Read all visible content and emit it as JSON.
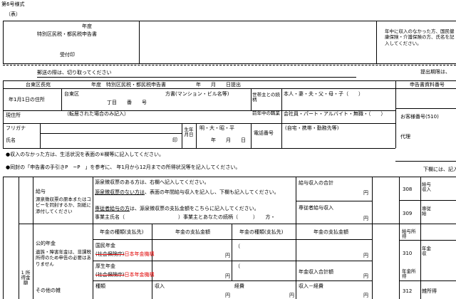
{
  "header": {
    "form_number": "第6号様式",
    "side_label": "（表）",
    "year_label": "年度",
    "form_title": "特別区民税・都民税申告書",
    "receipt": "受付印",
    "right_note": "年中に収入のなかった方、国民健康保険・介護保険の方、氏名を記入してください。",
    "postmark_note": "郵送の際は、切り取ってください",
    "submit_date_label": "提出期限は、"
  },
  "address_block": {
    "ward_head": "台東区長宛",
    "submit_line": "年度　特別区民税・都民税申告書　　　　　　年　　月　　日提出",
    "doc_number_label": "申告書資料番号",
    "jan1_address_label": "年1月1日の住所",
    "ward_name": "台東区",
    "building_label": "方書(マンション・ビル名等)",
    "chome_label": "丁目　　番　　号",
    "householder_label": "世帯主との続柄",
    "relation_options": "本人・妻・夫・父・母・子（　　）",
    "current_address_label": "現住所",
    "current_note": "（転居された場合のみ記入）",
    "previous_job_label": "前年中の職業",
    "job_options": "会社員・パート・アルバイト・無職・（　　）",
    "account_label": "お客様番号(510)",
    "furigana_label": "フリガナ",
    "birth_label": "生年月日",
    "era_options": "明・大・昭・平",
    "birth_date_label": "年　　月　　日",
    "phone_label": "電話番号",
    "phone_note": "(自宅・携帯・勤務先等)",
    "name_label": "氏名",
    "seal": "印",
    "agent_label": "代理"
  },
  "notes": {
    "note1": "●収入のなかった方は、生活状況を表面の⑥欄等に記入してください。",
    "note2": "●同封の「申告書の手引きP　~P　」を参考に、 年1月から12月までの所得状況等を記入してください。",
    "lower_note": "下欄には、記入しな"
  },
  "income": {
    "side_label": "1 所得金額",
    "salary": {
      "title": "給与",
      "left_note": "源泉徴収票の原本またはコピーを同封するか、別紙に添付してください",
      "line1": "源泉徴収票のある方は、右欄へ記入してください。",
      "line2_under": "源泉徴収票のない方は",
      "line2_rest": "、表面の年間給与収入を記入し、下欄も記入してください。",
      "line3_under": "専従者給与の方",
      "line3_rest": "は、源泉徴収票の支払金額をこちらに記入してください。",
      "employer_label": "事業主氏名（",
      "employer_relation": "）事業主とあなたの続柄（　　　）　　方・",
      "total_label": "給与収入の合計",
      "yen1": "円",
      "family_label": "専従者給与収入",
      "yen2": "円"
    },
    "pension": {
      "title": "公的年金",
      "note": "遺族・障害年金は、非課税所得のため申告の必要はありません",
      "col1": "年金の種類(支払先)",
      "col2": "年金の支払金額",
      "col3": "年金の種類(支払先)",
      "col4": "年金の支払金額",
      "national": "国民年金",
      "national_strike": "(社会保険庁)",
      "national_red": "日本年金機構",
      "welfare": "厚生年金",
      "welfare_strike": "(社会保険庁)",
      "welfare_red": "日本年金機構",
      "paren_open": "（",
      "paren_open2": "（",
      "yen_a": "円",
      "yen_b": "円",
      "yen_c": "円",
      "total_label": "年金収入合計額",
      "yen_total": "円"
    },
    "other": {
      "title": "その他の雑",
      "col1": "種類",
      "col2": "収入",
      "col3": "経費",
      "col4": "収入－経費",
      "yen_a": "円",
      "yen_b": "円",
      "yen_c": "円"
    },
    "codes": [
      {
        "code": "308",
        "label": "給与収入"
      },
      {
        "code": "309",
        "label": "専従給"
      },
      {
        "code": "310",
        "label": "年金収"
      },
      {
        "code": "312",
        "label": "雑所得"
      }
    ],
    "side_codes": {
      "salary_income": "給与所得",
      "pension_income": "年金所得"
    }
  }
}
